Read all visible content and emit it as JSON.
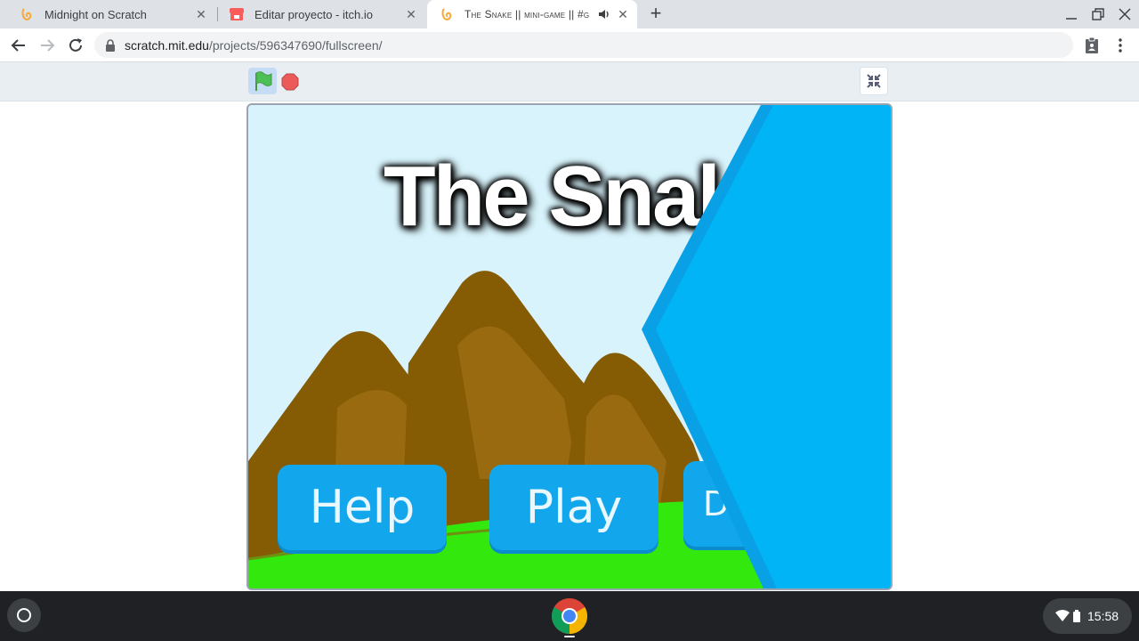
{
  "browser": {
    "tabs": [
      {
        "title": "Midnight on Scratch",
        "favicon": "scratch-cat-icon",
        "active": false
      },
      {
        "title": "Editar proyecto - itch.io",
        "favicon": "itch-io-icon",
        "active": false
      },
      {
        "title": "The Snake || mini-game || #g",
        "favicon": "scratch-cat-icon",
        "active": true,
        "audio": true
      }
    ],
    "new_tab_label": "+",
    "address": {
      "domain": "scratch.mit.edu",
      "path": "/projects/596347690/fullscreen/"
    }
  },
  "game": {
    "title": "The Snak",
    "buttons": {
      "help": "Help",
      "play": "Play",
      "partial": "D"
    }
  },
  "shelf": {
    "clock": "15:58"
  },
  "colors": {
    "sky": "#d8f3fb",
    "mountain_dark": "#855b04",
    "mountain_light": "#9a6a10",
    "grass": "#33e80c",
    "button_blue": "#12a7ec",
    "wipe_blue": "#00b4f5",
    "wipe_edge": "#0aa0e6",
    "flag_green": "#4cbf56",
    "stop_red": "#ec5959"
  }
}
